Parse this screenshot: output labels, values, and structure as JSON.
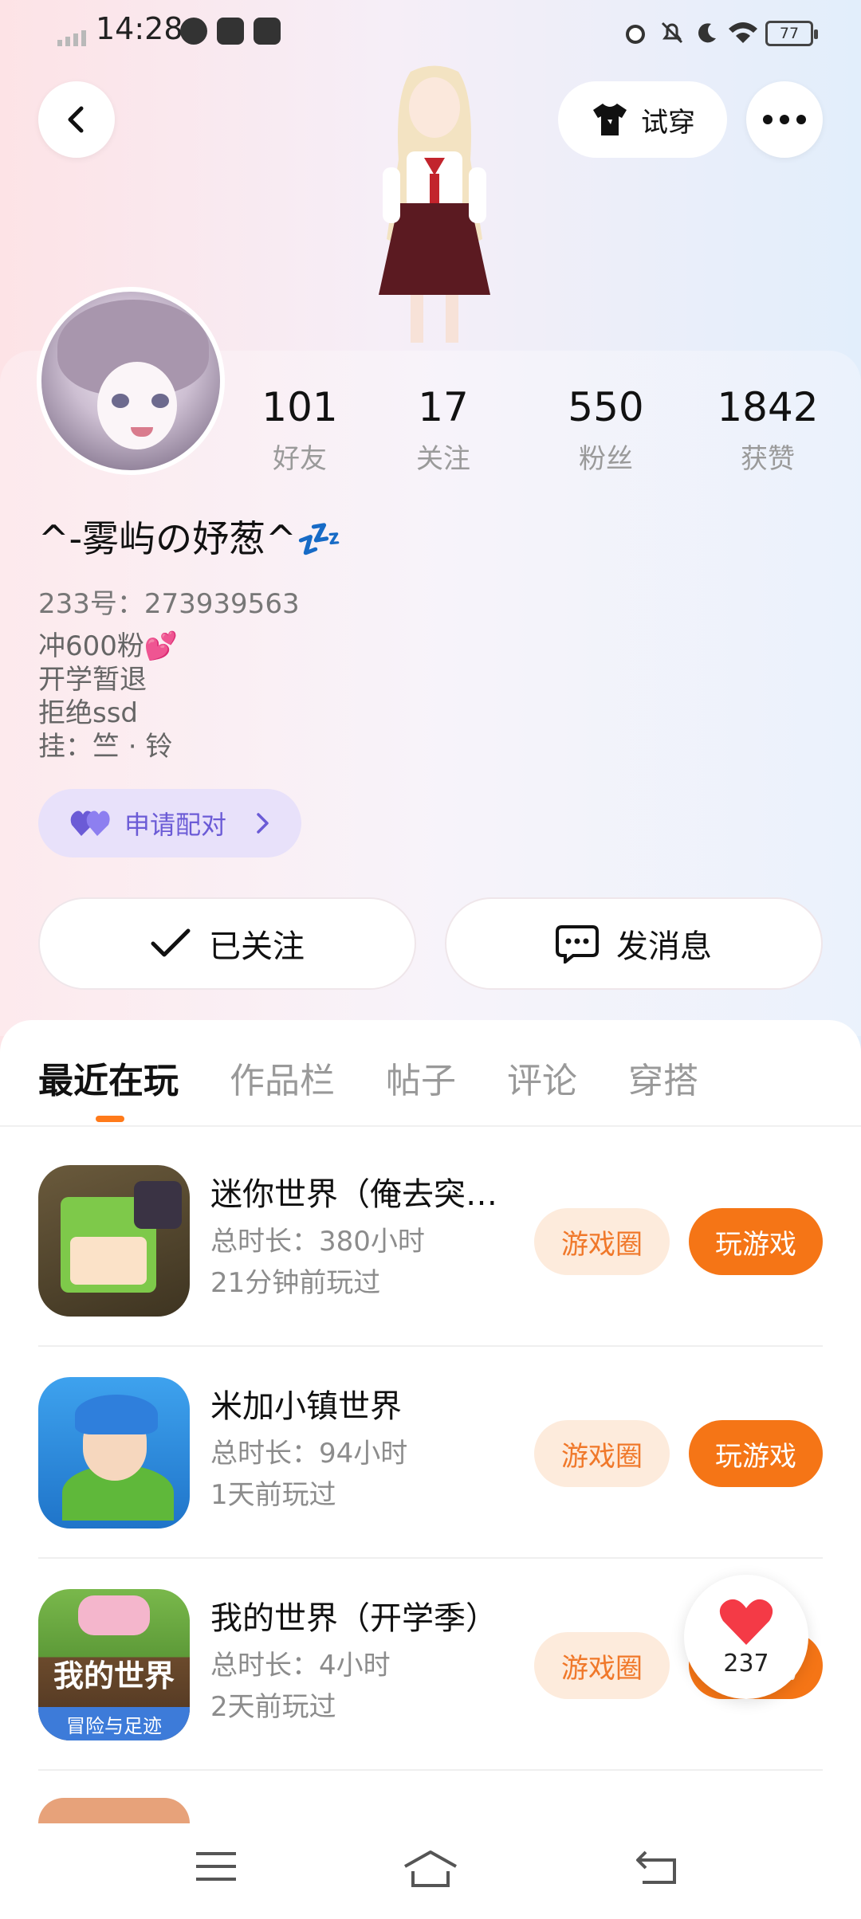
{
  "status_bar": {
    "time": "14:28",
    "battery": "77"
  },
  "header": {
    "tryon_label": "试穿"
  },
  "profile": {
    "stats": [
      {
        "num": "101",
        "label": "好友"
      },
      {
        "num": "17",
        "label": "关注"
      },
      {
        "num": "550",
        "label": "粉丝"
      },
      {
        "num": "1842",
        "label": "获赞"
      }
    ],
    "nickname": "^-雾屿の妤葱^💤",
    "uid": "233号：273939563",
    "bio": [
      "冲600粉💕",
      "开学暂退",
      "拒绝ssd",
      "挂：竺 · 铃"
    ],
    "pair_label": "申请配对",
    "follow_label": "已关注",
    "message_label": "发消息"
  },
  "tabs": [
    "最近在玩",
    "作品栏",
    "帖子",
    "评论",
    "穿搭"
  ],
  "games": [
    {
      "name": "迷你世界（俺去突…",
      "duration": "总时长：380小时",
      "last_played": "21分钟前玩过",
      "circle": "游戏圈",
      "play": "玩游戏"
    },
    {
      "name": "米加小镇世界",
      "duration": "总时长：94小时",
      "last_played": "1天前玩过",
      "circle": "游戏圈",
      "play": "玩游戏"
    },
    {
      "name": "我的世界（开学季）",
      "duration": "总时长：4小时",
      "last_played": "2天前玩过",
      "circle": "游戏圈",
      "play": "玩游戏"
    }
  ],
  "game_icon_text": {
    "g3_title": "我的世界",
    "g3_sub": "冒险与足迹"
  },
  "like": {
    "count": "237"
  },
  "colors": {
    "accent": "#f57516",
    "accent_light": "#fdebdc",
    "pair": "#6b5bd6"
  }
}
